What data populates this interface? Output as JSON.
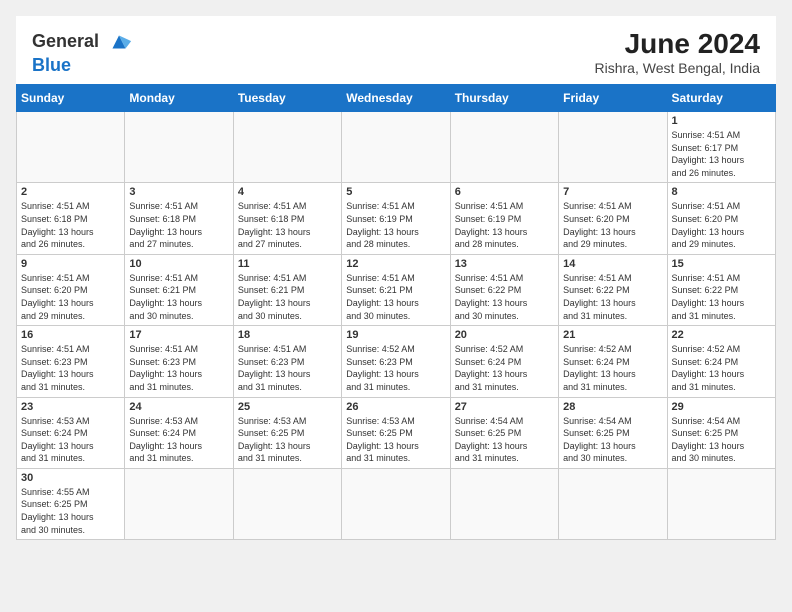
{
  "header": {
    "logo": {
      "line1": "General",
      "line2": "Blue"
    },
    "title": "June 2024",
    "subtitle": "Rishra, West Bengal, India"
  },
  "weekdays": [
    "Sunday",
    "Monday",
    "Tuesday",
    "Wednesday",
    "Thursday",
    "Friday",
    "Saturday"
  ],
  "weeks": [
    [
      {
        "day": "",
        "info": ""
      },
      {
        "day": "",
        "info": ""
      },
      {
        "day": "",
        "info": ""
      },
      {
        "day": "",
        "info": ""
      },
      {
        "day": "",
        "info": ""
      },
      {
        "day": "",
        "info": ""
      },
      {
        "day": "1",
        "info": "Sunrise: 4:51 AM\nSunset: 6:17 PM\nDaylight: 13 hours\nand 26 minutes."
      }
    ],
    [
      {
        "day": "2",
        "info": "Sunrise: 4:51 AM\nSunset: 6:18 PM\nDaylight: 13 hours\nand 26 minutes."
      },
      {
        "day": "3",
        "info": "Sunrise: 4:51 AM\nSunset: 6:18 PM\nDaylight: 13 hours\nand 27 minutes."
      },
      {
        "day": "4",
        "info": "Sunrise: 4:51 AM\nSunset: 6:18 PM\nDaylight: 13 hours\nand 27 minutes."
      },
      {
        "day": "5",
        "info": "Sunrise: 4:51 AM\nSunset: 6:19 PM\nDaylight: 13 hours\nand 28 minutes."
      },
      {
        "day": "6",
        "info": "Sunrise: 4:51 AM\nSunset: 6:19 PM\nDaylight: 13 hours\nand 28 minutes."
      },
      {
        "day": "7",
        "info": "Sunrise: 4:51 AM\nSunset: 6:20 PM\nDaylight: 13 hours\nand 29 minutes."
      },
      {
        "day": "8",
        "info": "Sunrise: 4:51 AM\nSunset: 6:20 PM\nDaylight: 13 hours\nand 29 minutes."
      }
    ],
    [
      {
        "day": "9",
        "info": "Sunrise: 4:51 AM\nSunset: 6:20 PM\nDaylight: 13 hours\nand 29 minutes."
      },
      {
        "day": "10",
        "info": "Sunrise: 4:51 AM\nSunset: 6:21 PM\nDaylight: 13 hours\nand 30 minutes."
      },
      {
        "day": "11",
        "info": "Sunrise: 4:51 AM\nSunset: 6:21 PM\nDaylight: 13 hours\nand 30 minutes."
      },
      {
        "day": "12",
        "info": "Sunrise: 4:51 AM\nSunset: 6:21 PM\nDaylight: 13 hours\nand 30 minutes."
      },
      {
        "day": "13",
        "info": "Sunrise: 4:51 AM\nSunset: 6:22 PM\nDaylight: 13 hours\nand 30 minutes."
      },
      {
        "day": "14",
        "info": "Sunrise: 4:51 AM\nSunset: 6:22 PM\nDaylight: 13 hours\nand 31 minutes."
      },
      {
        "day": "15",
        "info": "Sunrise: 4:51 AM\nSunset: 6:22 PM\nDaylight: 13 hours\nand 31 minutes."
      }
    ],
    [
      {
        "day": "16",
        "info": "Sunrise: 4:51 AM\nSunset: 6:23 PM\nDaylight: 13 hours\nand 31 minutes."
      },
      {
        "day": "17",
        "info": "Sunrise: 4:51 AM\nSunset: 6:23 PM\nDaylight: 13 hours\nand 31 minutes."
      },
      {
        "day": "18",
        "info": "Sunrise: 4:51 AM\nSunset: 6:23 PM\nDaylight: 13 hours\nand 31 minutes."
      },
      {
        "day": "19",
        "info": "Sunrise: 4:52 AM\nSunset: 6:23 PM\nDaylight: 13 hours\nand 31 minutes."
      },
      {
        "day": "20",
        "info": "Sunrise: 4:52 AM\nSunset: 6:24 PM\nDaylight: 13 hours\nand 31 minutes."
      },
      {
        "day": "21",
        "info": "Sunrise: 4:52 AM\nSunset: 6:24 PM\nDaylight: 13 hours\nand 31 minutes."
      },
      {
        "day": "22",
        "info": "Sunrise: 4:52 AM\nSunset: 6:24 PM\nDaylight: 13 hours\nand 31 minutes."
      }
    ],
    [
      {
        "day": "23",
        "info": "Sunrise: 4:53 AM\nSunset: 6:24 PM\nDaylight: 13 hours\nand 31 minutes."
      },
      {
        "day": "24",
        "info": "Sunrise: 4:53 AM\nSunset: 6:24 PM\nDaylight: 13 hours\nand 31 minutes."
      },
      {
        "day": "25",
        "info": "Sunrise: 4:53 AM\nSunset: 6:25 PM\nDaylight: 13 hours\nand 31 minutes."
      },
      {
        "day": "26",
        "info": "Sunrise: 4:53 AM\nSunset: 6:25 PM\nDaylight: 13 hours\nand 31 minutes."
      },
      {
        "day": "27",
        "info": "Sunrise: 4:54 AM\nSunset: 6:25 PM\nDaylight: 13 hours\nand 31 minutes."
      },
      {
        "day": "28",
        "info": "Sunrise: 4:54 AM\nSunset: 6:25 PM\nDaylight: 13 hours\nand 30 minutes."
      },
      {
        "day": "29",
        "info": "Sunrise: 4:54 AM\nSunset: 6:25 PM\nDaylight: 13 hours\nand 30 minutes."
      }
    ],
    [
      {
        "day": "30",
        "info": "Sunrise: 4:55 AM\nSunset: 6:25 PM\nDaylight: 13 hours\nand 30 minutes."
      },
      {
        "day": "",
        "info": ""
      },
      {
        "day": "",
        "info": ""
      },
      {
        "day": "",
        "info": ""
      },
      {
        "day": "",
        "info": ""
      },
      {
        "day": "",
        "info": ""
      },
      {
        "day": "",
        "info": ""
      }
    ]
  ]
}
